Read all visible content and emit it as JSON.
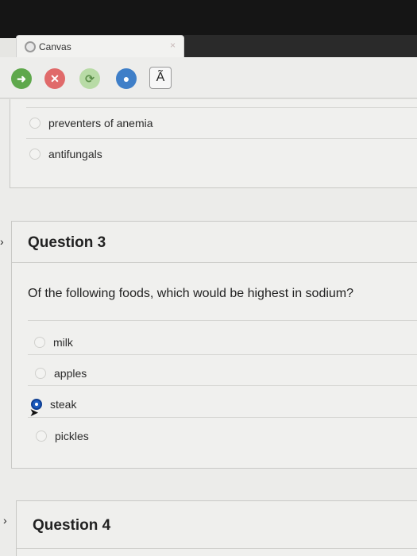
{
  "browser": {
    "tab_title": "Canvas",
    "tab_close": "×",
    "toolbar_char": "Ã"
  },
  "prev_question": {
    "answers": [
      "preventers of anemia",
      "antifungals"
    ]
  },
  "question3": {
    "title": "Question 3",
    "text": "Of the following foods, which would be highest in sodium?",
    "answers": [
      "milk",
      "apples",
      "steak",
      "pickles"
    ],
    "selected": "steak"
  },
  "question4": {
    "title": "Question 4"
  },
  "colors": {
    "selected_radio": "#1a5bbf",
    "back_button": "#5fa84c",
    "stop_button": "#e06a6a"
  }
}
